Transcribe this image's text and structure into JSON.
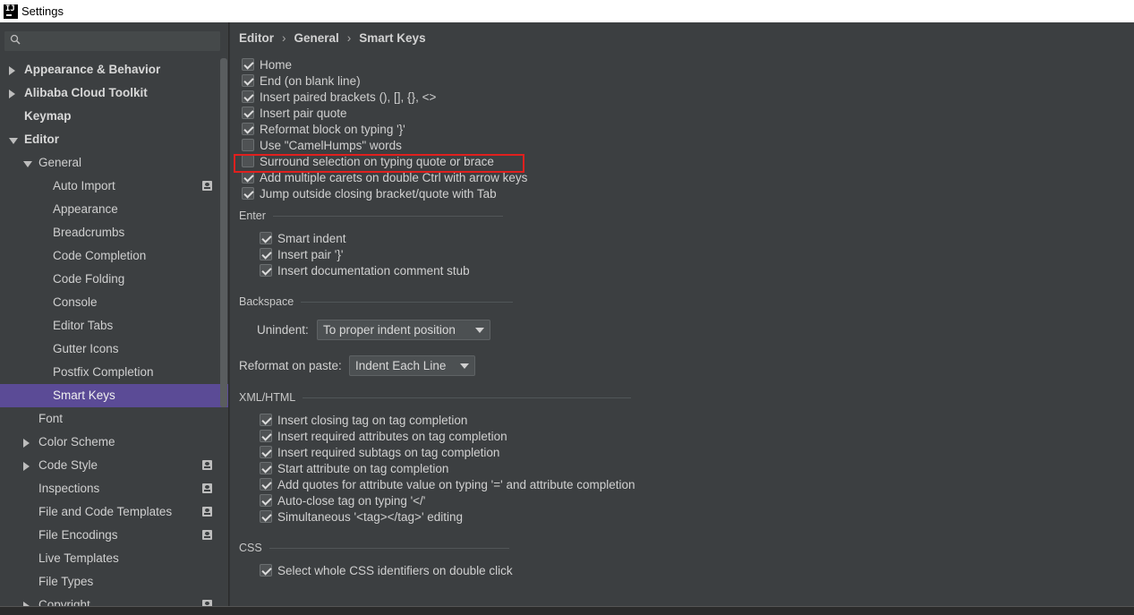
{
  "window": {
    "title": "Settings",
    "app_icon": "intellij-icon"
  },
  "search": {
    "placeholder": "",
    "value": ""
  },
  "sidebar": {
    "items": [
      {
        "label": "Appearance & Behavior",
        "arrow": "right"
      },
      {
        "label": "Alibaba Cloud Toolkit",
        "arrow": "right"
      },
      {
        "label": "Keymap",
        "arrow": ""
      },
      {
        "label": "Editor",
        "arrow": "down"
      },
      {
        "label": "General",
        "arrow": "down"
      },
      {
        "label": "Auto Import",
        "project_icon": true
      },
      {
        "label": "Appearance"
      },
      {
        "label": "Breadcrumbs"
      },
      {
        "label": "Code Completion"
      },
      {
        "label": "Code Folding"
      },
      {
        "label": "Console"
      },
      {
        "label": "Editor Tabs"
      },
      {
        "label": "Gutter Icons"
      },
      {
        "label": "Postfix Completion"
      },
      {
        "label": "Smart Keys",
        "selected": true
      },
      {
        "label": "Font"
      },
      {
        "label": "Color Scheme",
        "arrow": "right"
      },
      {
        "label": "Code Style",
        "arrow": "right",
        "project_icon": true
      },
      {
        "label": "Inspections",
        "project_icon": true
      },
      {
        "label": "File and Code Templates",
        "project_icon": true
      },
      {
        "label": "File Encodings",
        "project_icon": true
      },
      {
        "label": "Live Templates"
      },
      {
        "label": "File Types"
      },
      {
        "label": "Copyright",
        "arrow": "right",
        "project_icon": true
      }
    ]
  },
  "breadcrumb": {
    "part1": "Editor",
    "part2": "General",
    "part3": "Smart Keys",
    "separator": "›"
  },
  "general_options": [
    {
      "label": "Home",
      "checked": true
    },
    {
      "label": "End (on blank line)",
      "checked": true
    },
    {
      "label": "Insert paired brackets (), [], {}, <>",
      "checked": true
    },
    {
      "label": "Insert pair quote",
      "checked": true
    },
    {
      "label": "Reformat block on typing '}'",
      "checked": true
    },
    {
      "label": "Use \"CamelHumps\" words",
      "checked": false
    },
    {
      "label": "Surround selection on typing quote or brace",
      "checked": false,
      "highlighted": true
    },
    {
      "label": "Add multiple carets on double Ctrl with arrow keys",
      "checked": true
    },
    {
      "label": "Jump outside closing bracket/quote with Tab",
      "checked": true
    }
  ],
  "enter": {
    "title": "Enter",
    "options": [
      {
        "label": "Smart indent",
        "checked": true
      },
      {
        "label": "Insert pair '}'",
        "checked": true
      },
      {
        "label": "Insert documentation comment stub",
        "checked": true
      }
    ]
  },
  "backspace": {
    "title": "Backspace",
    "unindent_label": "Unindent:",
    "unindent_value": "To proper indent position",
    "reformat_label": "Reformat on paste:",
    "reformat_value": "Indent Each Line"
  },
  "xml_html": {
    "title": "XML/HTML",
    "options": [
      {
        "label": "Insert closing tag on tag completion",
        "checked": true
      },
      {
        "label": "Insert required attributes on tag completion",
        "checked": true
      },
      {
        "label": "Insert required subtags on tag completion",
        "checked": true
      },
      {
        "label": "Start attribute on tag completion",
        "checked": true
      },
      {
        "label": "Add quotes for attribute value on typing '=' and attribute completion",
        "checked": true
      },
      {
        "label": "Auto-close tag on typing '</'",
        "checked": true
      },
      {
        "label": "Simultaneous '<tag></tag>' editing",
        "checked": true
      }
    ]
  },
  "css": {
    "title": "CSS",
    "options": [
      {
        "label": "Select whole CSS identifiers on double click",
        "checked": true
      }
    ]
  },
  "colors": {
    "selection": "#5b4b96",
    "highlight_box": "#e0201e",
    "panel": "#3c3f41"
  }
}
